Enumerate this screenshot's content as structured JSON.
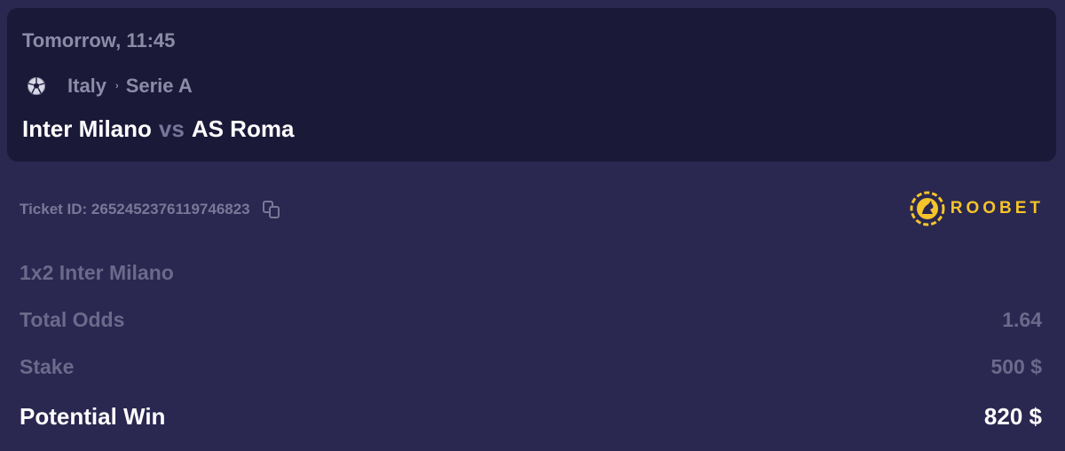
{
  "match": {
    "time": "Tomorrow, 11:45",
    "country": "Italy",
    "separator": "›",
    "league": "Serie A",
    "home_team": "Inter Milano",
    "vs_label": "vs",
    "away_team": "AS Roma",
    "sport_icon": "soccer-ball-icon"
  },
  "ticket": {
    "id_label": "Ticket ID: 2652452376119746823",
    "copy_icon": "copy-icon"
  },
  "brand": {
    "name": "ROOBET",
    "logo_icon": "roobet-kangaroo-logo",
    "color": "#f4c42a"
  },
  "bet": {
    "selection": "1x2 Inter Milano",
    "total_odds_label": "Total Odds",
    "total_odds_value": "1.64",
    "stake_label": "Stake",
    "stake_value": "500 $",
    "potential_win_label": "Potential Win",
    "potential_win_value": "820 $"
  },
  "colors": {
    "background": "#2a2750",
    "card": "#1b1938",
    "muted_text": "#8d8ba6",
    "highlight_text": "#ffffff"
  }
}
